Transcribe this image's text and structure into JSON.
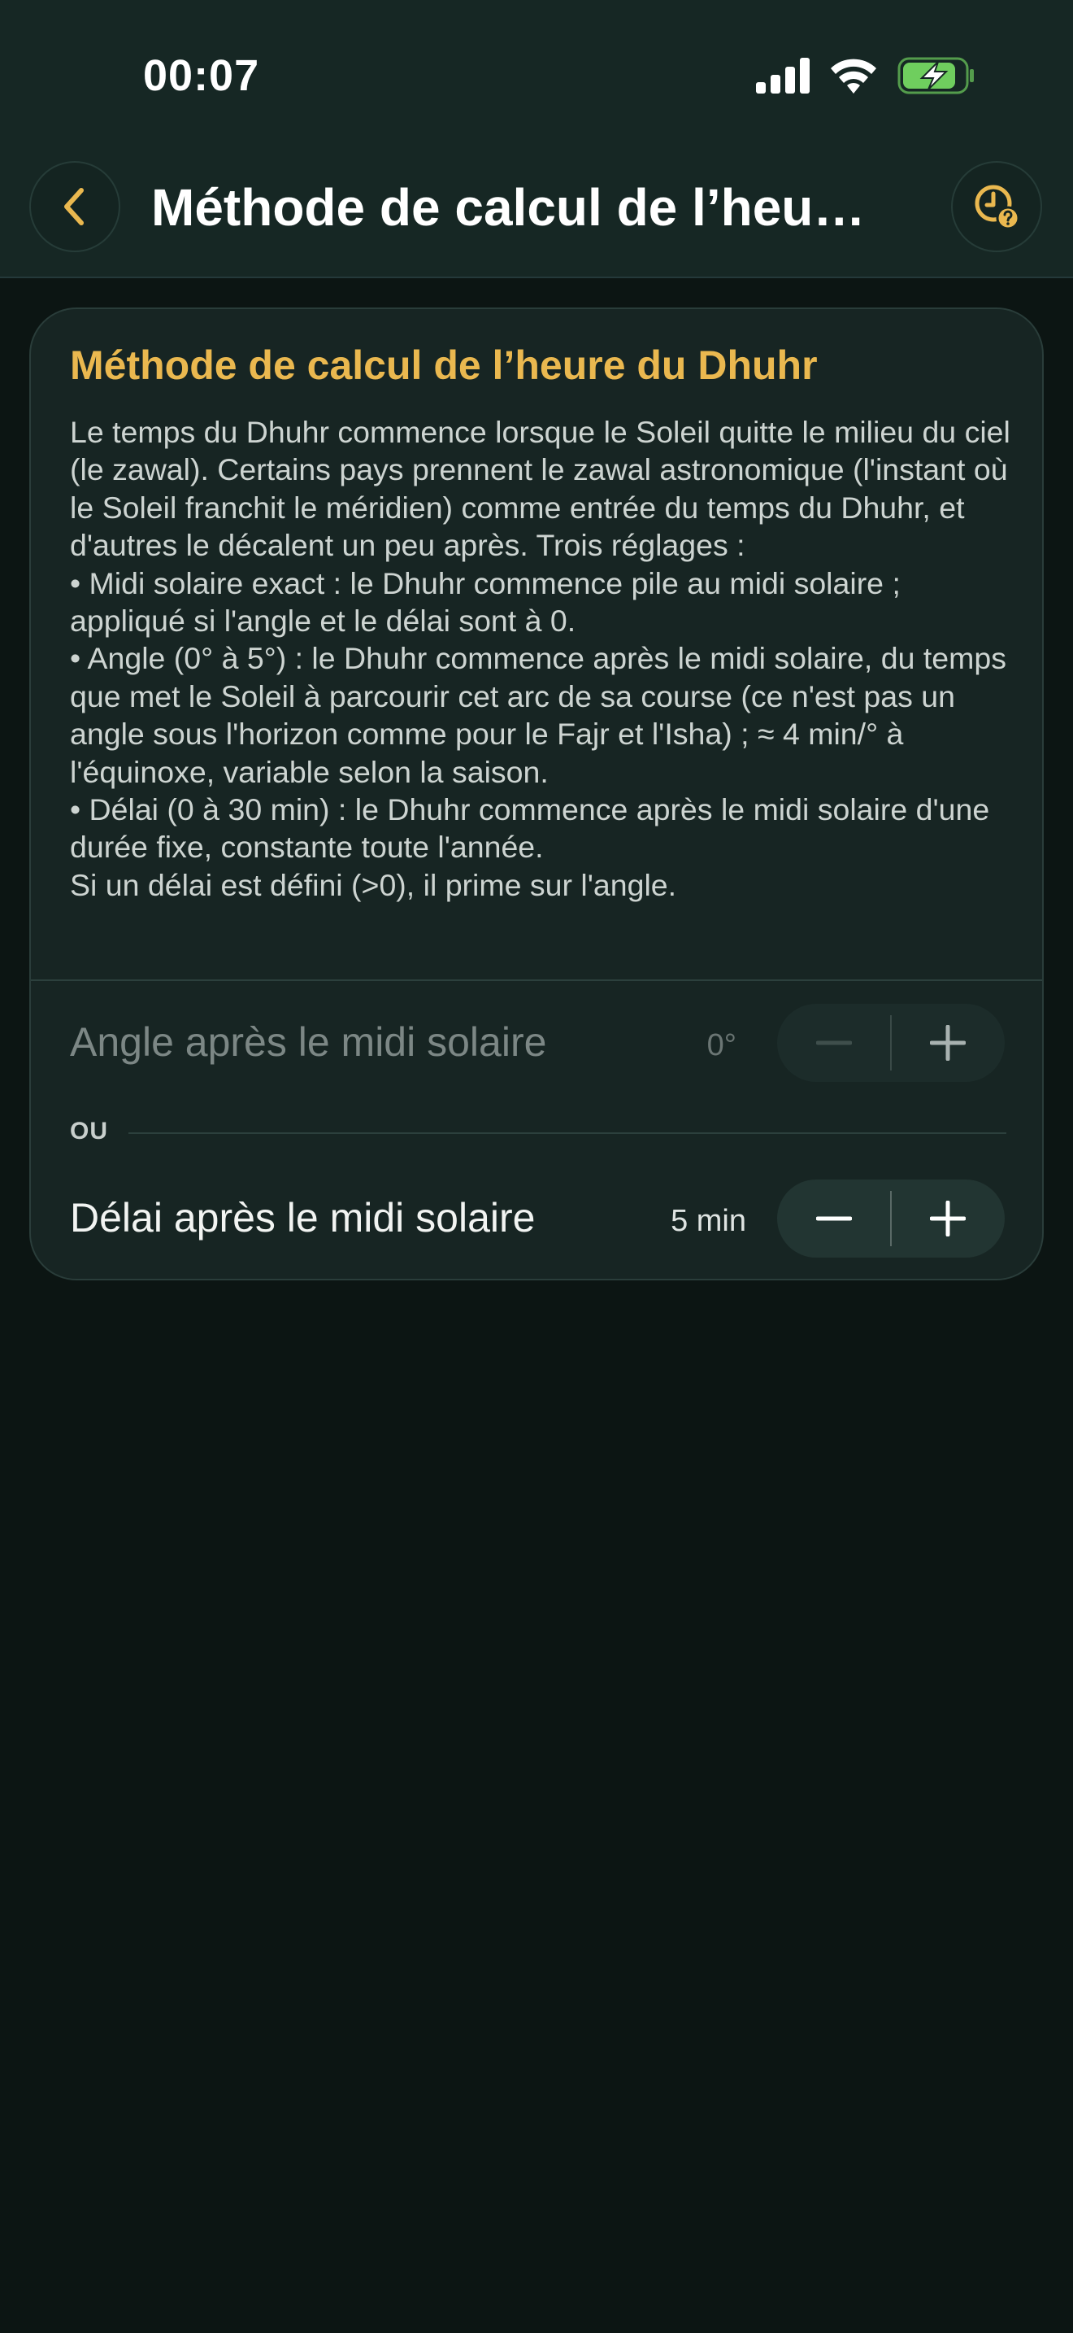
{
  "status_bar": {
    "time": "00:07"
  },
  "nav": {
    "title": "Méthode de calcul de l’heure du Dhuhr"
  },
  "card": {
    "title": "Méthode de calcul de l’heure du Dhuhr",
    "description": "Le temps du Dhuhr commence lorsque le Soleil quitte le milieu du ciel (le zawal). Certains pays prennent le zawal astronomique (l'instant où le Soleil franchit le méridien) comme entrée du temps du Dhuhr, et d'autres le décalent un peu après. Trois réglages :\n• Midi solaire exact : le Dhuhr commence pile au midi solaire ; appliqué si l'angle et le délai sont à 0.\n• Angle (0° à 5°) : le Dhuhr commence après le midi solaire, du temps que met le Soleil à parcourir cet arc de sa course (ce n'est pas un angle sous l'horizon comme pour le Fajr et l'Isha) ; ≈ 4 min/° à l'équinoxe, variable selon la saison.\n• Délai (0 à 30 min) : le Dhuhr commence après le midi solaire d'une durée fixe, constante toute l'année.\nSi un délai est défini (>0), il prime sur l'angle.",
    "angle_row": {
      "label": "Angle après le midi solaire",
      "value": "0°",
      "enabled": false
    },
    "separator": "OU",
    "delay_row": {
      "label": "Délai après le midi solaire",
      "value": "5 min",
      "enabled": true
    }
  },
  "colors": {
    "accent": "#eab84f",
    "background": "#0c1513",
    "card": "#172523",
    "header": "#162724",
    "battery": "#6fce5e"
  },
  "icons": {
    "back": "chevron-left-icon",
    "help": "clock-question-icon",
    "minus": "minus-icon",
    "plus": "plus-icon"
  }
}
